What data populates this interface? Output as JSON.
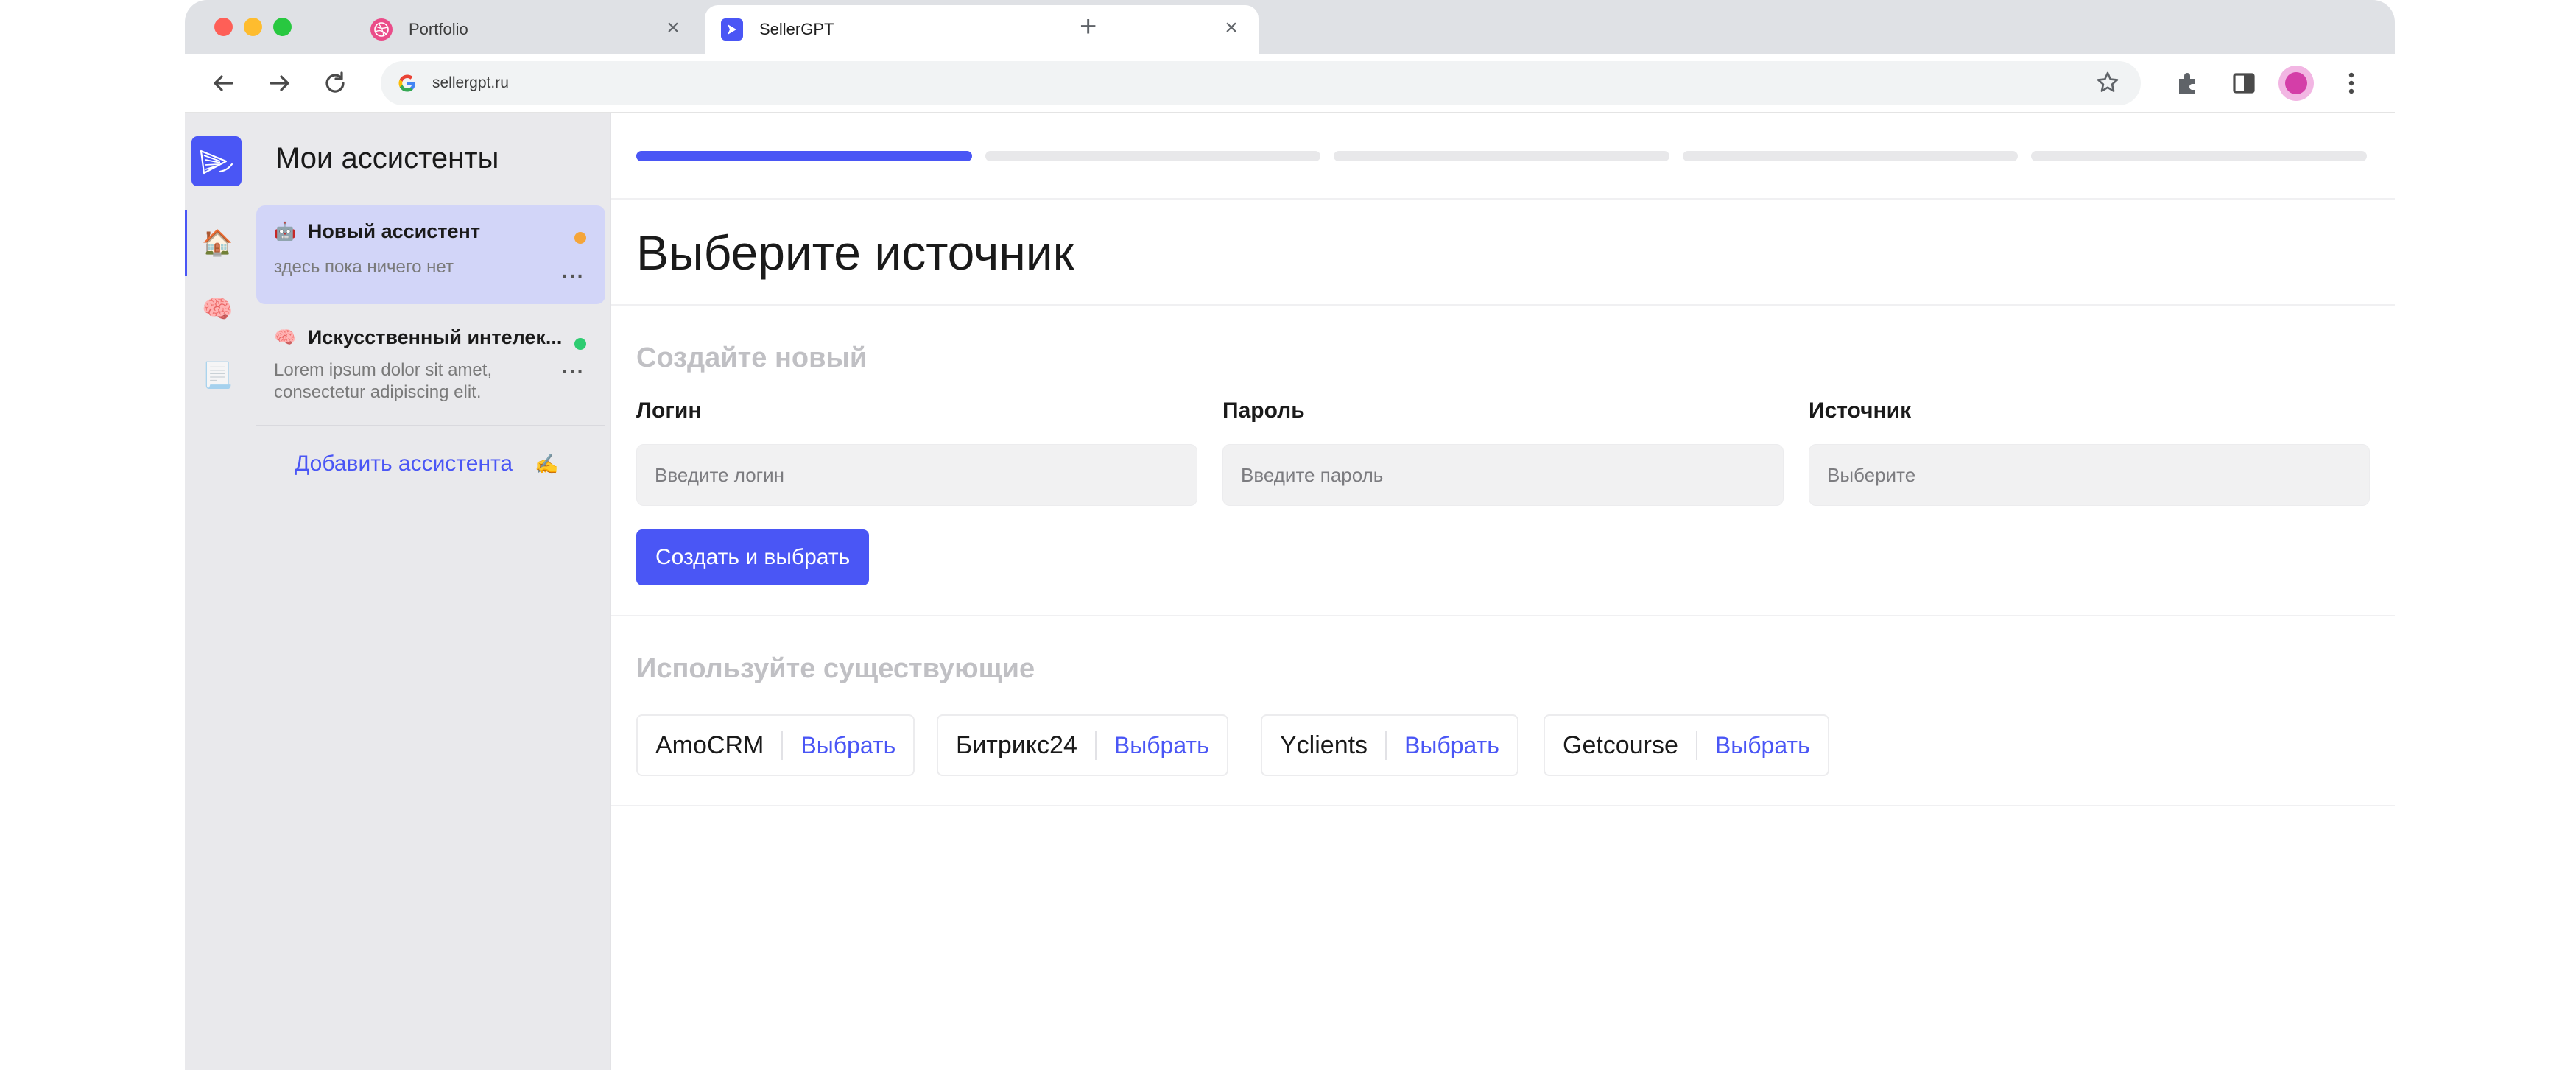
{
  "browser": {
    "tabs": [
      {
        "title": "Portfolio"
      },
      {
        "title": "SellerGPT"
      }
    ],
    "url": "sellergpt.ru"
  },
  "rail": {
    "items": [
      {
        "icon": "house-icon",
        "glyph": "🏠"
      },
      {
        "icon": "brain-icon",
        "glyph": "🧠"
      },
      {
        "icon": "document-icon",
        "glyph": "📃"
      }
    ]
  },
  "sidebar": {
    "title": "Мои ассистенты",
    "assistants": [
      {
        "emoji": "🤖",
        "name": "Новый ассистент",
        "subtitle": "здесь пока ничего нет",
        "status_color": "#f5a53a",
        "more": "···"
      },
      {
        "emoji": "🧠",
        "name": "Искусственный интелек...",
        "subtitle": "Lorem ipsum dolor sit amet, consectetur adipiscing elit.",
        "status_color": "#2ecc71",
        "more": "···"
      }
    ],
    "add_label": "Добавить ассистента",
    "add_icon": "✍️"
  },
  "main": {
    "progress": {
      "steps": 5,
      "current": 1
    },
    "title": "Выберите источник",
    "create_section": {
      "title": "Создайте новый",
      "fields": [
        {
          "label": "Логин",
          "placeholder": "Введите логин"
        },
        {
          "label": "Пароль",
          "placeholder": "Введите пароль"
        },
        {
          "label": "Источник",
          "placeholder": "Выберите"
        }
      ],
      "submit_label": "Создать и выбрать"
    },
    "existing_section": {
      "title": "Используйте существующие",
      "sources": [
        {
          "name": "AmoCRM",
          "action": "Выбрать"
        },
        {
          "name": "Битрикс24",
          "action": "Выбрать"
        },
        {
          "name": "Yclients",
          "action": "Выбрать"
        },
        {
          "name": "Getcourse",
          "action": "Выбрать"
        }
      ]
    }
  },
  "colors": {
    "accent": "#4a56f5",
    "active_assistant_bg": "#d2d5f8"
  }
}
